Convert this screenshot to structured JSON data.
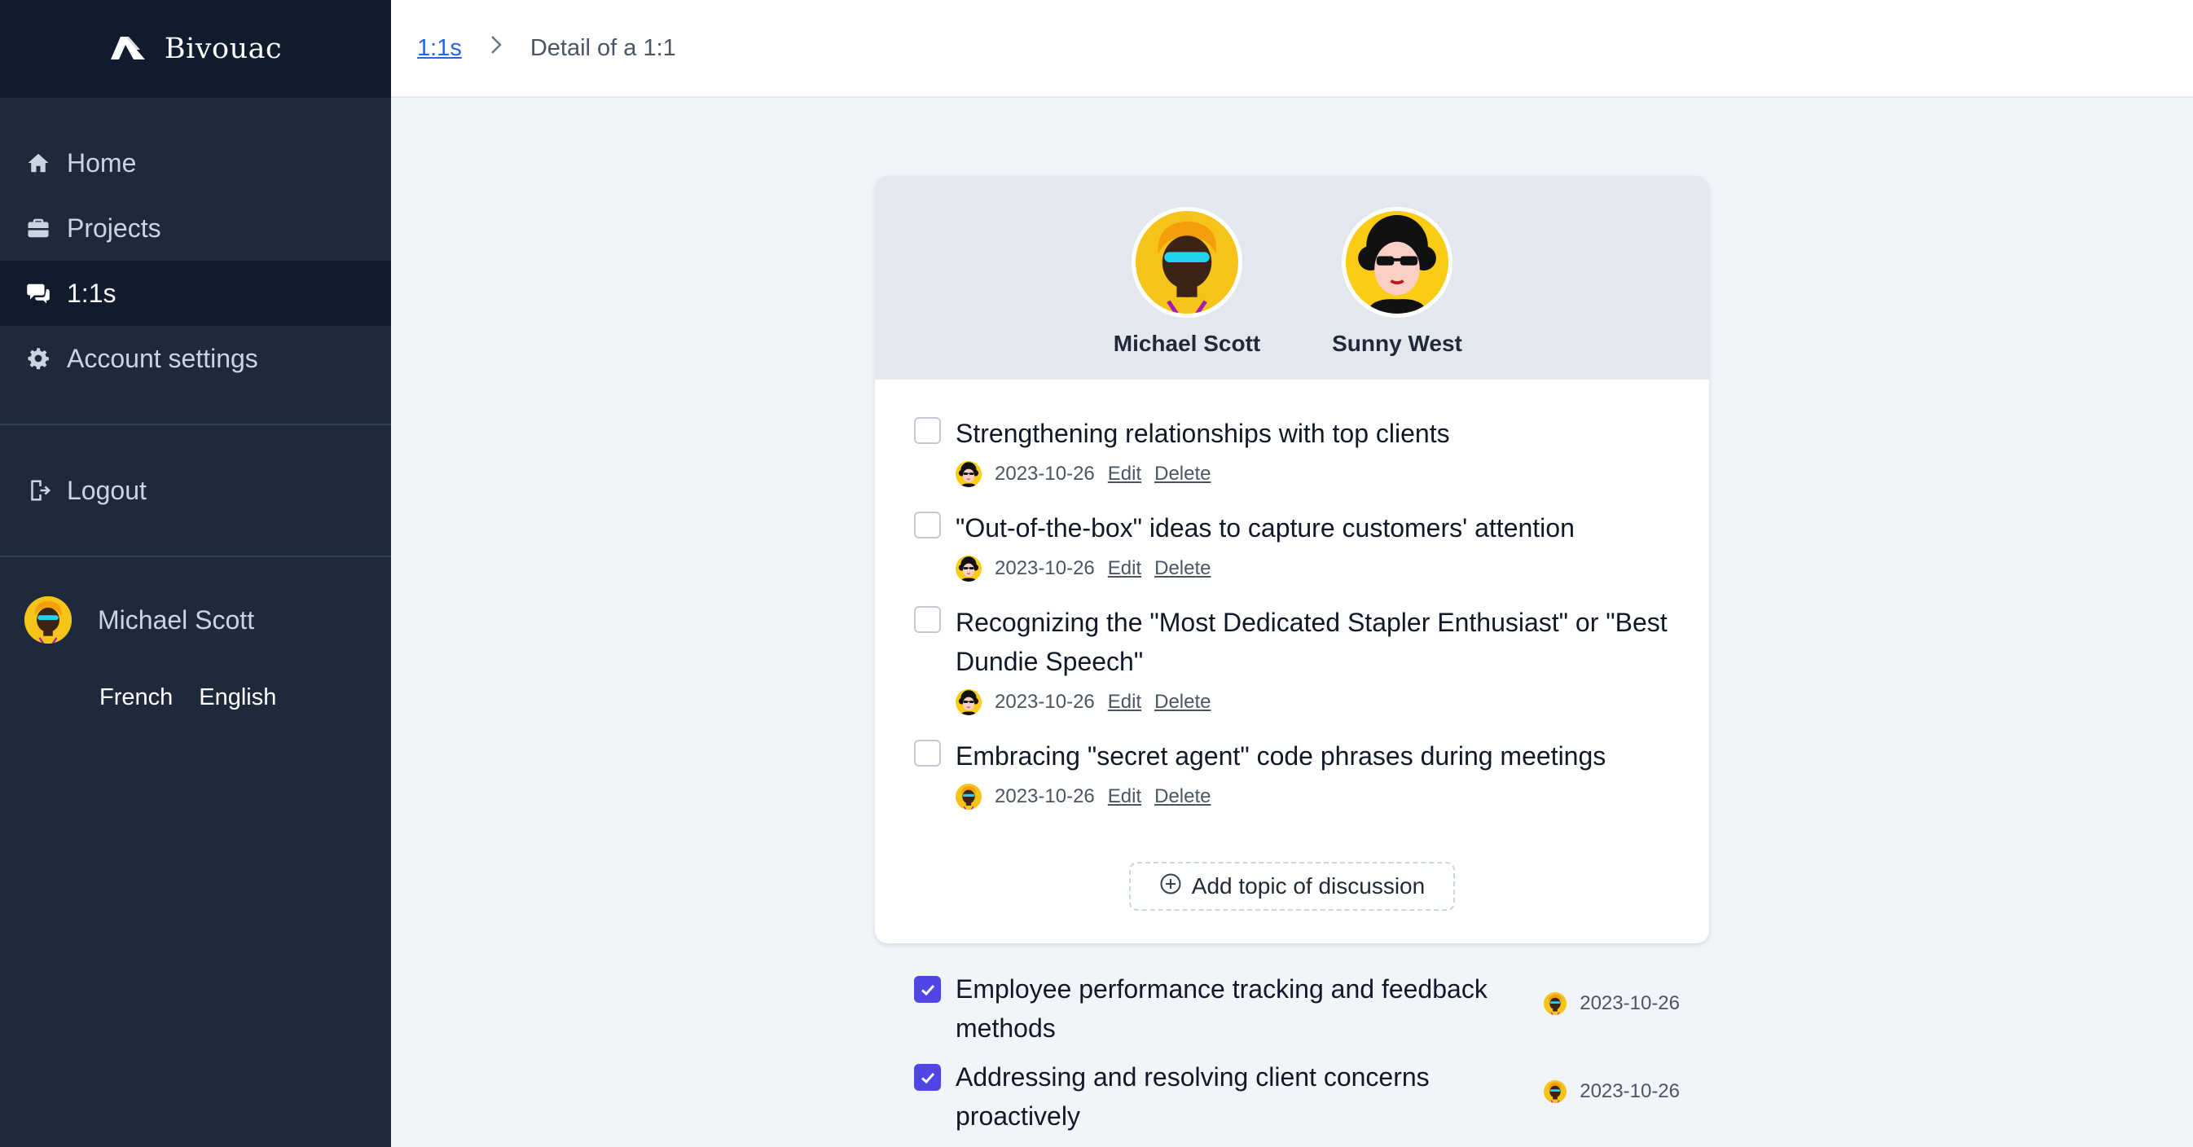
{
  "app": {
    "name": "Bivouac",
    "logo_icon": "tent-icon"
  },
  "sidebar": {
    "items": [
      {
        "label": "Home",
        "icon": "home-icon"
      },
      {
        "label": "Projects",
        "icon": "briefcase-icon"
      },
      {
        "label": "1:1s",
        "icon": "chat-bubbles-icon",
        "active": true
      },
      {
        "label": "Account settings",
        "icon": "gear-icon"
      }
    ],
    "logout": {
      "label": "Logout",
      "icon": "logout-icon"
    },
    "user": {
      "name": "Michael Scott"
    },
    "languages": [
      "French",
      "English"
    ]
  },
  "breadcrumb": {
    "parent": "1:1s",
    "current": "Detail of a 1:1"
  },
  "meeting": {
    "participants": [
      {
        "name": "Michael Scott"
      },
      {
        "name": "Sunny West"
      }
    ],
    "topics": [
      {
        "title": "Strengthening relationships with top clients",
        "date": "2023-10-26",
        "author": "sunny"
      },
      {
        "title": "\"Out-of-the-box\" ideas to capture customers' attention",
        "date": "2023-10-26",
        "author": "sunny"
      },
      {
        "title": "Recognizing the \"Most Dedicated Stapler Enthusiast\" or \"Best Dundie Speech\"",
        "date": "2023-10-26",
        "author": "sunny"
      },
      {
        "title": "Embracing \"secret agent\" code phrases during meetings",
        "date": "2023-10-26",
        "author": "michael"
      }
    ],
    "edit_label": "Edit",
    "delete_label": "Delete",
    "add_topic_label": "Add topic of discussion",
    "done_topics": [
      {
        "title": "Employee performance tracking and feedback methods",
        "date": "2023-10-26",
        "checked": true
      },
      {
        "title": "Addressing and resolving client concerns proactively",
        "date": "2023-10-26",
        "checked": true
      }
    ]
  },
  "colors": {
    "sidebar_bg": "#1e293b",
    "accent": "#4f46e5",
    "link": "#2563eb",
    "page_bg": "#f1f4f9"
  }
}
